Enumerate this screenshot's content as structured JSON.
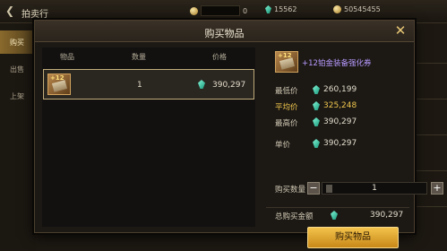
{
  "topbar": {
    "title": "拍卖行",
    "currency_1": "0",
    "currency_2": "15562",
    "currency_3": "50545455"
  },
  "sidebar": {
    "items": [
      {
        "label": "购买"
      },
      {
        "label": "出售"
      },
      {
        "label": "上架"
      }
    ]
  },
  "dialog": {
    "title": "购买物品",
    "columns": {
      "item": "物品",
      "qty": "数量",
      "price": "价格"
    },
    "row": {
      "enhance": "+12",
      "qty": "1",
      "price": "390,297"
    },
    "detail": {
      "item_enhance": "+12",
      "item_name": "+12铂金装备强化券",
      "min_label": "最低价",
      "min_value": "260,199",
      "avg_label": "平均价",
      "avg_value": "325,248",
      "max_label": "最高价",
      "max_value": "390,297",
      "unit_label": "单价",
      "unit_value": "390,297",
      "qty_label": "购买数量",
      "qty_value": "1",
      "total_label": "总购买金额",
      "total_value": "390,297",
      "buy_label": "购买物品"
    }
  },
  "colors": {
    "accent_gold": "#f0c64c",
    "item_name": "#b89aff",
    "button": "#e0a530"
  }
}
